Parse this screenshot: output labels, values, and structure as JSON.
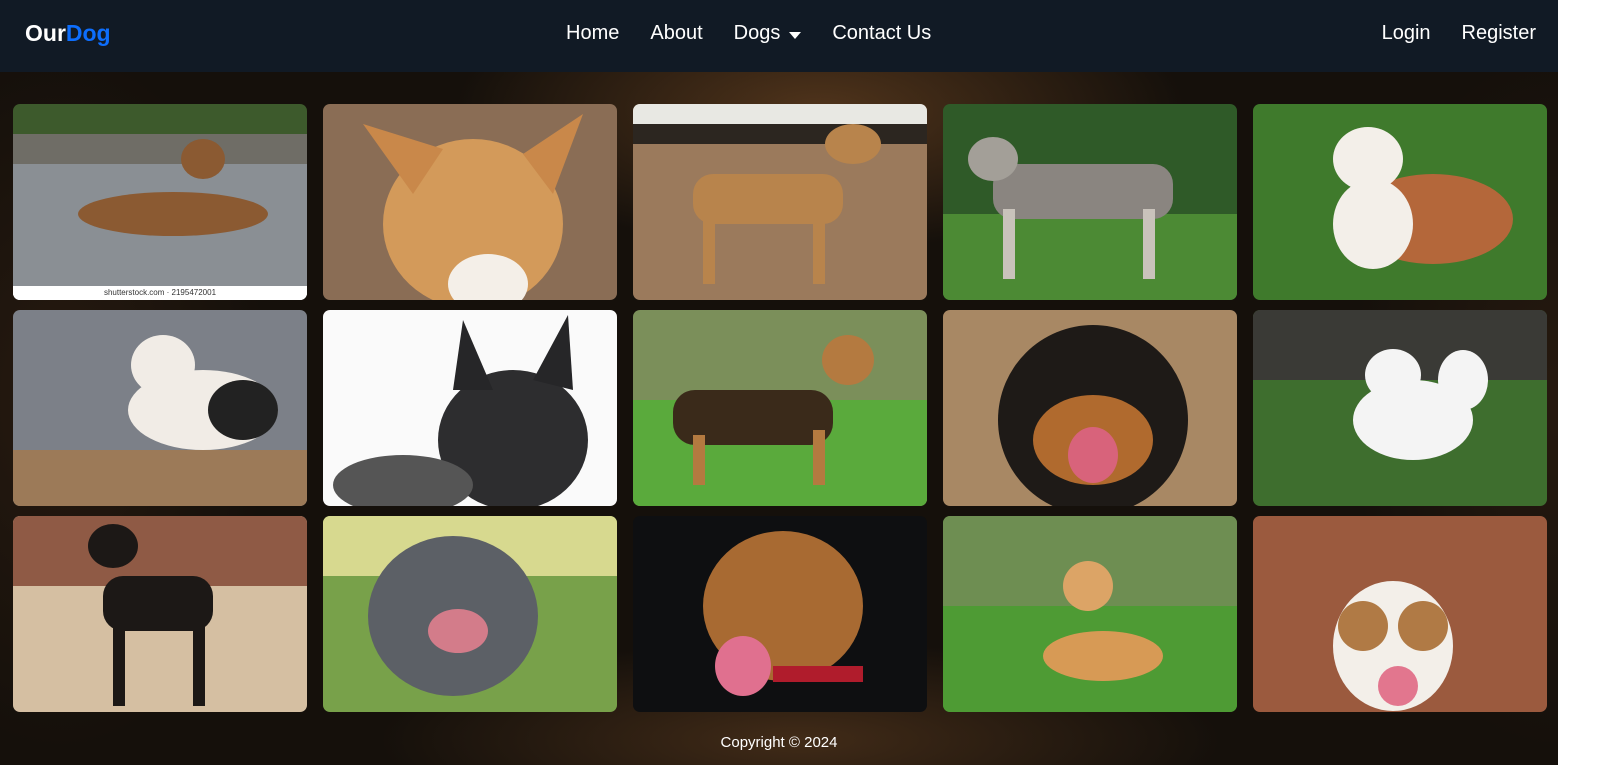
{
  "nav": {
    "brand_part1": "Our",
    "brand_part2": "Dog",
    "brand_color": "#0d6efd",
    "links": [
      "Home",
      "About",
      "Dogs",
      "Contact Us"
    ],
    "login": "Login",
    "register": "Register"
  },
  "gallery": {
    "row1": [
      "brown-dog-lying-on-road",
      "tan-white-dog-closeup",
      "tan-dog-on-leash",
      "wolfdog-standing",
      "english-bulldog"
    ],
    "row2": [
      "black-white-american-bulldog",
      "black-german-shepherd",
      "german-shepherd-on-grass",
      "rottweiler-closeup",
      "white-spitz-running"
    ],
    "row3": [
      "rottweiler-standing",
      "grey-cane-corso",
      "black-tan-mixed-dog",
      "shiba-inu-on-grass",
      "brown-white-dog-brick-wall"
    ],
    "watermark": "shutterstock.com · 2195472001"
  },
  "footer": {
    "text": "Copyright © 2024"
  }
}
